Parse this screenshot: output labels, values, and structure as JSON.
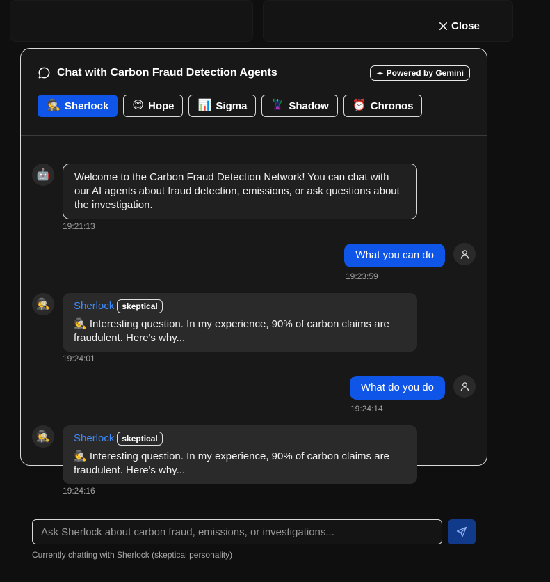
{
  "modal": {
    "close_label": "Close",
    "title": "Chat with Carbon Fraud Detection Agents",
    "powered_by": "Powered by Gemini"
  },
  "agents": [
    {
      "emoji": "🕵️",
      "label": "Sherlock",
      "active": true
    },
    {
      "emoji": "😊",
      "label": "Hope",
      "active": false
    },
    {
      "emoji": "📊",
      "label": "Sigma",
      "active": false
    },
    {
      "emoji": "🦹",
      "label": "Shadow",
      "active": false
    },
    {
      "emoji": "⏰",
      "label": "Chronos",
      "active": false
    }
  ],
  "messages": [
    {
      "role": "system",
      "avatar": "🤖",
      "text": "Welcome to the Carbon Fraud Detection Network! You can chat with our AI agents about fraud detection, emissions, or ask questions about the investigation.",
      "time": "19:21:13"
    },
    {
      "role": "user",
      "text": "What you can do",
      "time": "19:23:59"
    },
    {
      "role": "agent",
      "avatar": "🕵️",
      "name": "Sherlock",
      "mood": "skeptical",
      "text": "🕵️ Interesting question. In my experience, 90% of carbon claims are fraudulent. Here's why...",
      "time": "19:24:01"
    },
    {
      "role": "user",
      "text": "What do you do",
      "time": "19:24:14"
    },
    {
      "role": "agent",
      "avatar": "🕵️",
      "name": "Sherlock",
      "mood": "skeptical",
      "text": "🕵️ Interesting question. In my experience, 90% of carbon claims are fraudulent. Here's why...",
      "time": "19:24:16"
    }
  ],
  "input": {
    "placeholder": "Ask Sherlock about carbon fraud, emissions, or investigations...",
    "value": ""
  },
  "status": "Currently chatting with Sherlock (skeptical personality)",
  "colors": {
    "accent": "#0f56e8",
    "agent_name": "#3d8bff",
    "background": "#0f0f0f",
    "panel": "#181818"
  },
  "icons": {
    "close": "close-icon",
    "chat": "chat-bubble-icon",
    "sparkle": "sparkle-icon",
    "user": "user-icon",
    "send": "send-icon"
  }
}
